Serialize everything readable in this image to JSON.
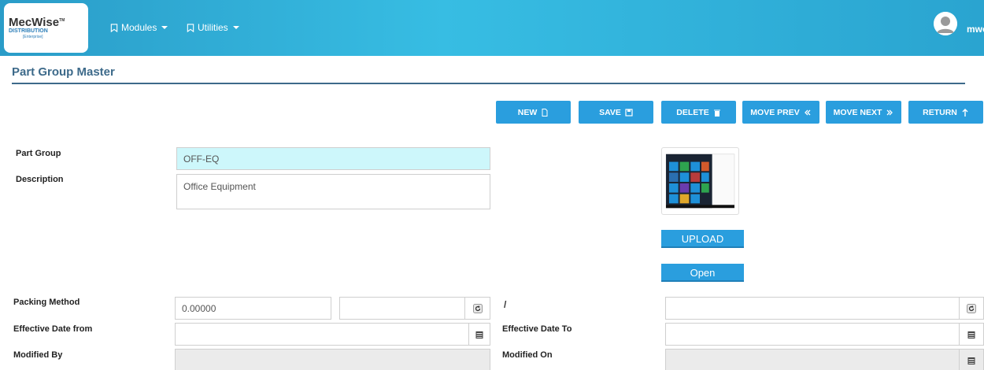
{
  "brand": {
    "name": "MecWise",
    "line2": "DISTRIBUTION",
    "line3": "[Enterprise]",
    "tm": "TM"
  },
  "nav": {
    "modules": "Modules",
    "utilities": "Utilities"
  },
  "user": {
    "name": "mwo"
  },
  "page": {
    "title": "Part Group Master"
  },
  "toolbar": {
    "new": "NEW",
    "save": "SAVE",
    "delete": "DELETE",
    "move_prev": "MOVE PREV",
    "move_next": "MOVE NEXT",
    "return": "RETURN"
  },
  "form": {
    "part_group_label": "Part Group",
    "part_group_value": "OFF-EQ",
    "description_label": "Description",
    "description_value": "Office Equipment",
    "upload": "UPLOAD",
    "open": "Open",
    "packing_method_label": "Packing Method",
    "packing_method_value": "0.00000",
    "packing_method_unit": "",
    "slash": "/",
    "packing_right_value": "",
    "effective_from_label": "Effective Date from",
    "effective_from_value": "",
    "effective_to_label": "Effective Date To",
    "effective_to_value": "",
    "modified_by_label": "Modified By",
    "modified_by_value": "",
    "modified_on_label": "Modified On",
    "modified_on_value": ""
  },
  "colors": {
    "accent": "#2a9ede",
    "header": "#37bde3",
    "title": "#3d6a8a",
    "highlight": "#cdf7fb"
  },
  "icons": [
    "bookmark-icon",
    "file-icon",
    "save-icon",
    "trash-icon",
    "chevrons-left-icon",
    "chevrons-right-icon",
    "arrow-up-icon",
    "refresh-icon",
    "calendar-icon",
    "user-avatar-icon"
  ]
}
